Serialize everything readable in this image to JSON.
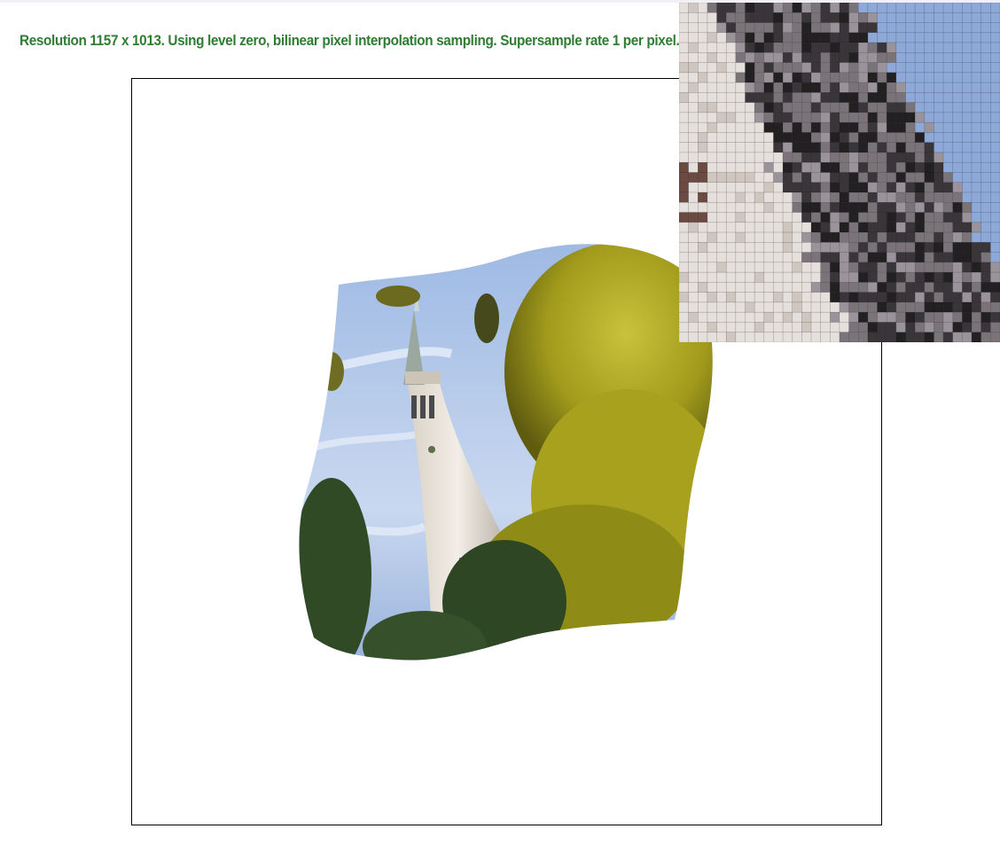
{
  "status": {
    "text": "Resolution 1157 x 1013. Using level zero, bilinear pixel interpolation sampling. Supersample rate 1 per pixel.",
    "color": "#2e7d32"
  },
  "viewport": {
    "content": "warped-photo-tower-and-trees"
  },
  "zoom": {
    "content": "magnified-pixel-grid",
    "grid_cols": 34,
    "grid_rows": 34,
    "palette": {
      "sky": "#8ea8d8",
      "light": "#e6e0dc",
      "mid": "#7a7479",
      "dark": "#3a3538",
      "darker": "#232022",
      "brown": "#6b4a42"
    }
  }
}
